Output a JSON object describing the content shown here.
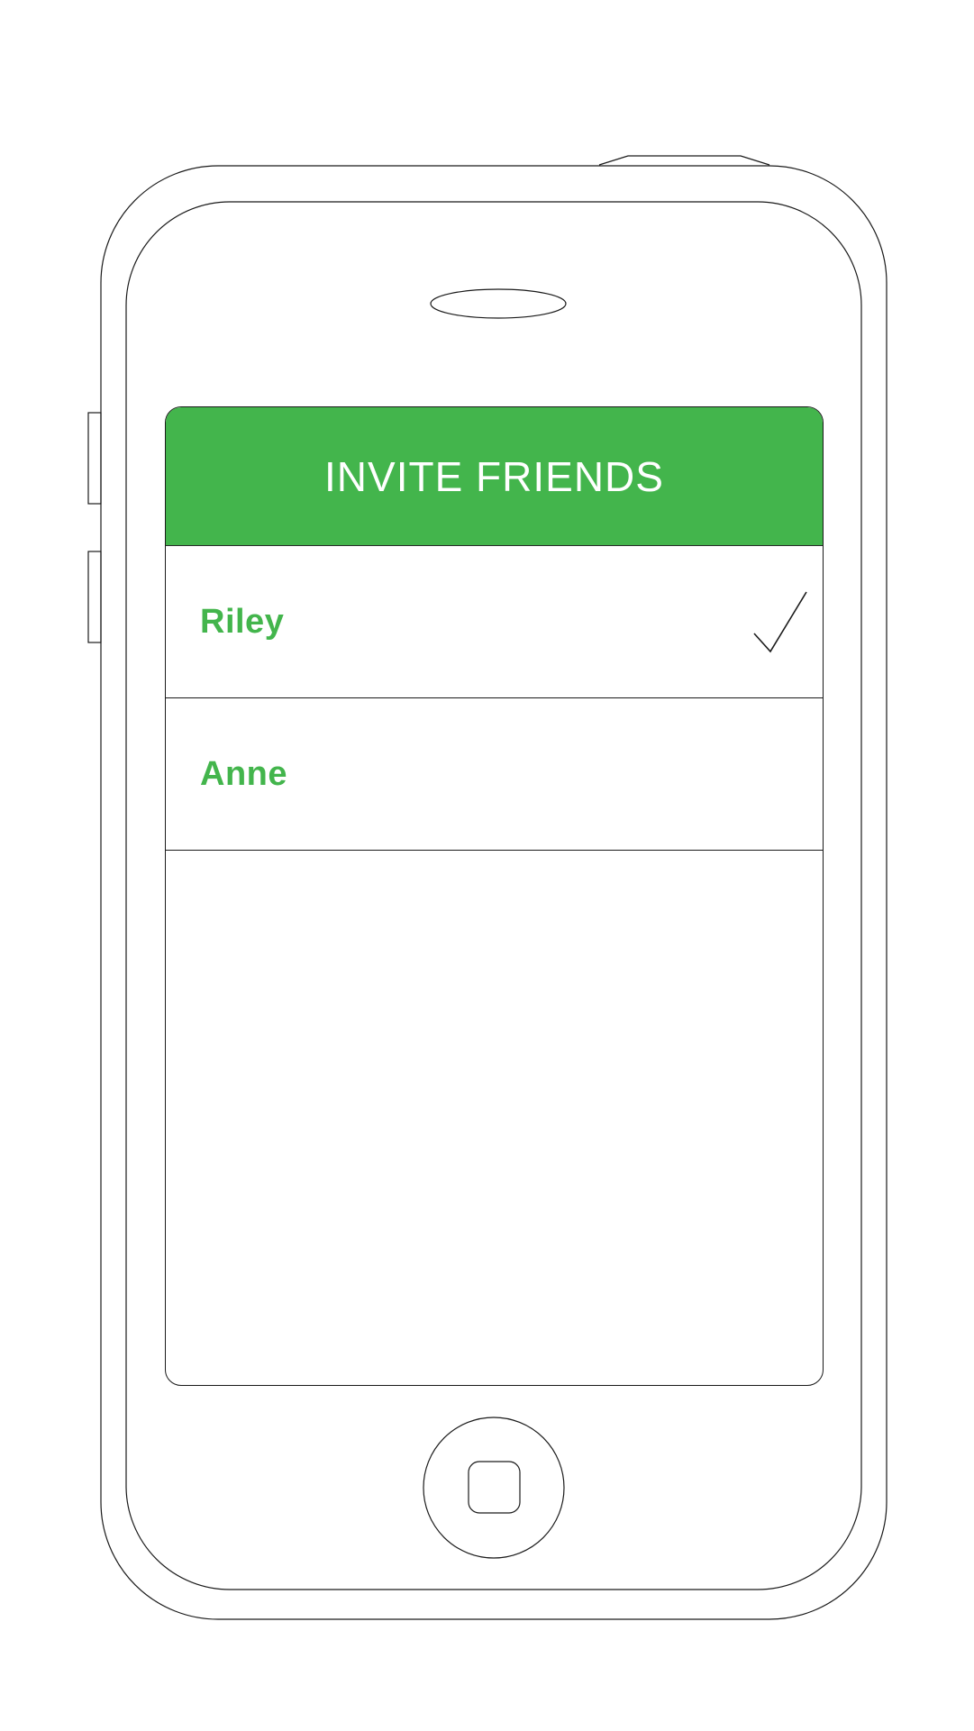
{
  "colors": {
    "accent": "#43b54c",
    "outline": "#1a1a1a",
    "background": "#ffffff"
  },
  "header": {
    "title": "INVITE FRIENDS"
  },
  "friends": [
    {
      "name": "Riley",
      "selected": true,
      "indicator_icon": "checkmark-icon"
    },
    {
      "name": "Anne",
      "selected": false,
      "indicator_icon": ""
    }
  ]
}
